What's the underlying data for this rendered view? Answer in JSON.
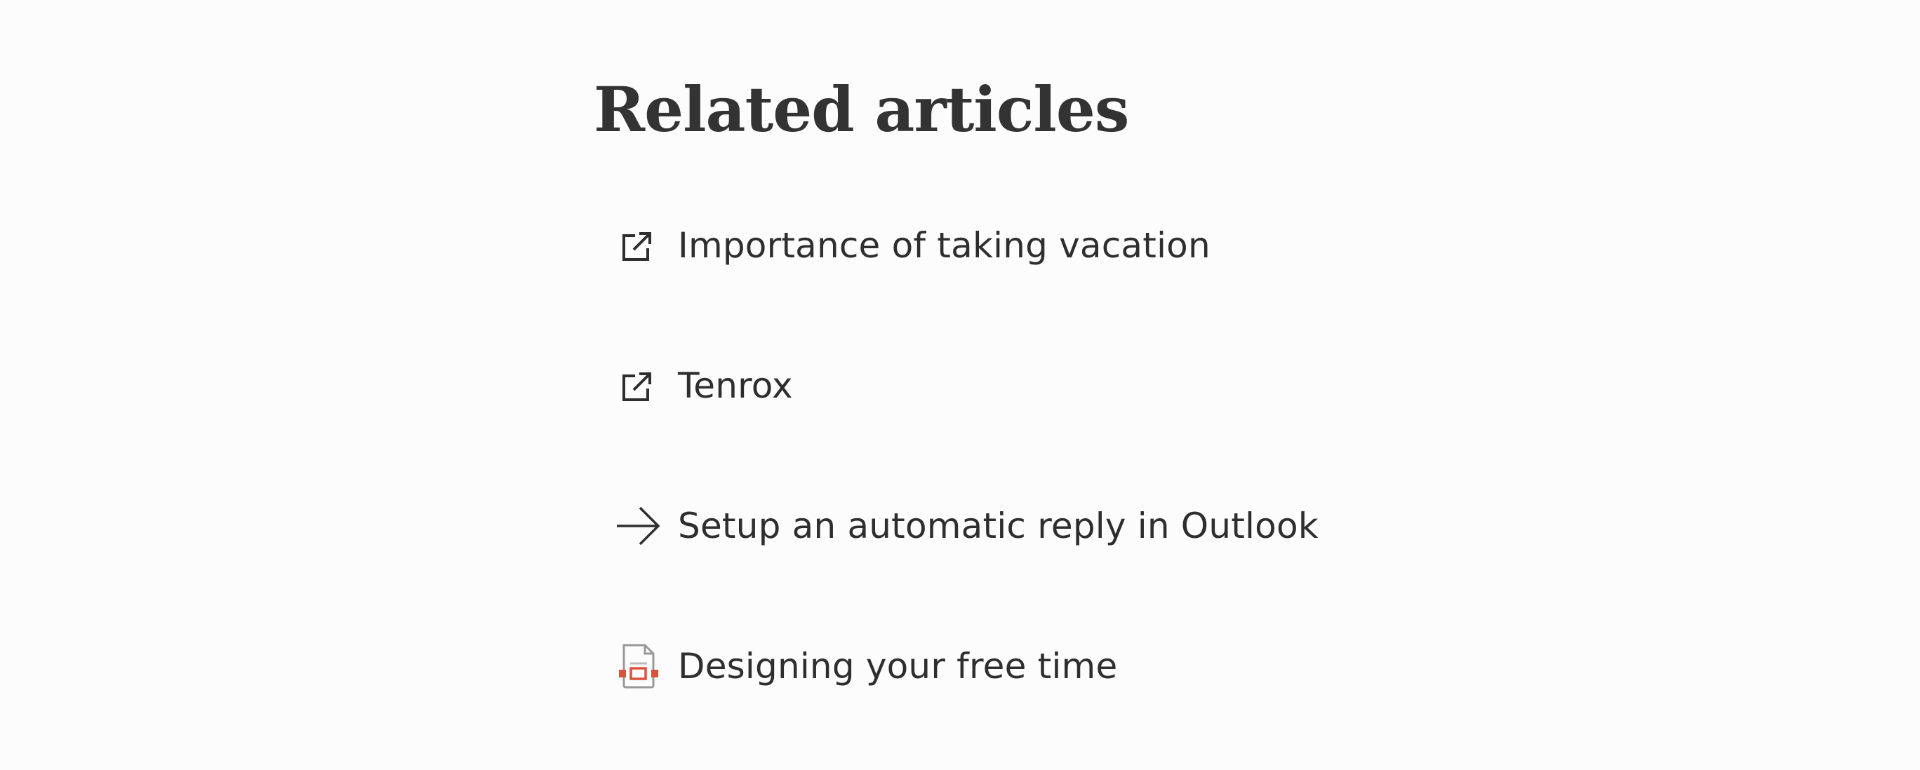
{
  "section": {
    "title": "Related articles"
  },
  "articles": [
    {
      "label": "Importance of taking vacation",
      "icon": "external-link-icon"
    },
    {
      "label": "Tenrox",
      "icon": "external-link-icon"
    },
    {
      "label": "Setup an automatic reply in Outlook",
      "icon": "arrow-right-icon"
    },
    {
      "label": "Designing your free time",
      "icon": "presentation-file-icon"
    }
  ],
  "colors": {
    "background": "#fcfcfc",
    "text": "#2e2e2e",
    "file_icon_accent": "#d9533b",
    "file_icon_outline": "#999999"
  }
}
